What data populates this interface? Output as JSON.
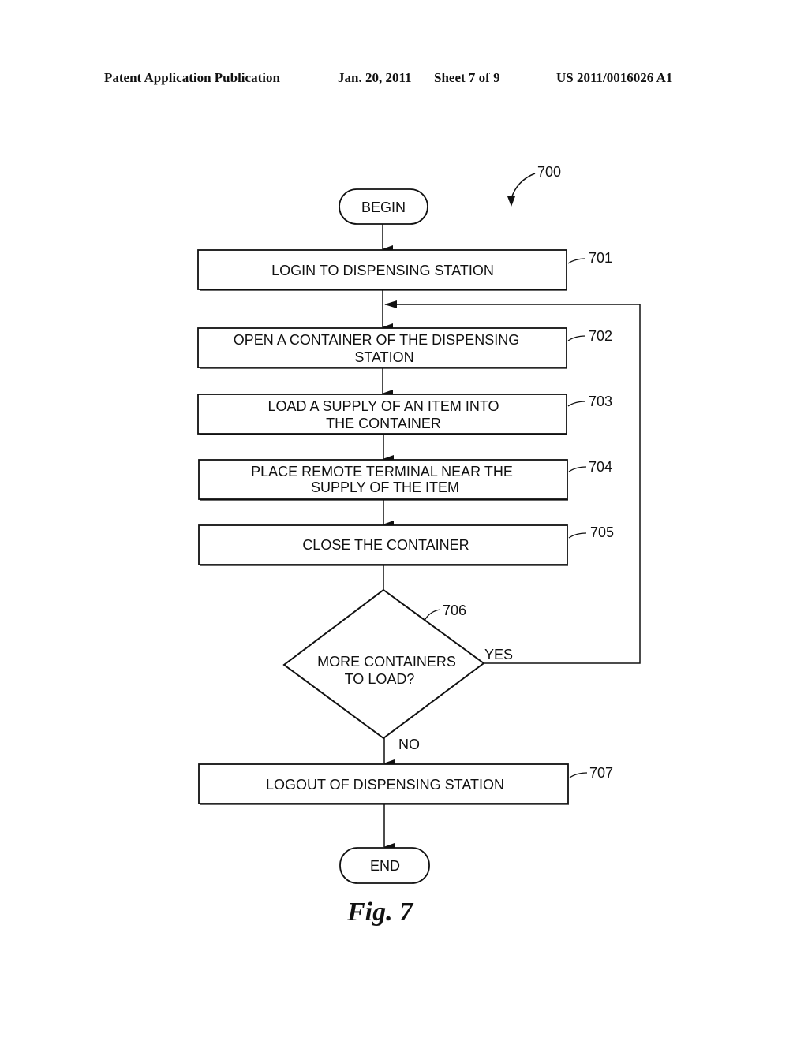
{
  "header": {
    "publication": "Patent Application Publication",
    "date": "Jan. 20, 2011",
    "sheet": "Sheet 7 of 9",
    "number": "US 2011/0016026 A1"
  },
  "figure": {
    "ref": "700",
    "label": "Fig. 7"
  },
  "nodes": {
    "begin": {
      "label": "BEGIN"
    },
    "step701": {
      "ref": "701",
      "lines": [
        "LOGIN TO DISPENSING STATION"
      ]
    },
    "step702": {
      "ref": "702",
      "lines": [
        "OPEN A CONTAINER OF THE DISPENSING",
        "STATION"
      ]
    },
    "step703": {
      "ref": "703",
      "lines": [
        "LOAD A SUPPLY OF AN ITEM INTO",
        "THE CONTAINER"
      ]
    },
    "step704": {
      "ref": "704",
      "lines": [
        "PLACE REMOTE TERMINAL NEAR THE",
        "SUPPLY OF THE ITEM"
      ]
    },
    "step705": {
      "ref": "705",
      "lines": [
        "CLOSE THE CONTAINER"
      ]
    },
    "decision706": {
      "ref": "706",
      "lines": [
        "MORE CONTAINERS",
        "TO LOAD?"
      ],
      "yes": "YES",
      "no": "NO"
    },
    "step707": {
      "ref": "707",
      "lines": [
        "LOGOUT OF DISPENSING STATION"
      ]
    },
    "end": {
      "label": "END"
    }
  },
  "colors": {
    "ink": "#111111",
    "paper": "#ffffff"
  }
}
